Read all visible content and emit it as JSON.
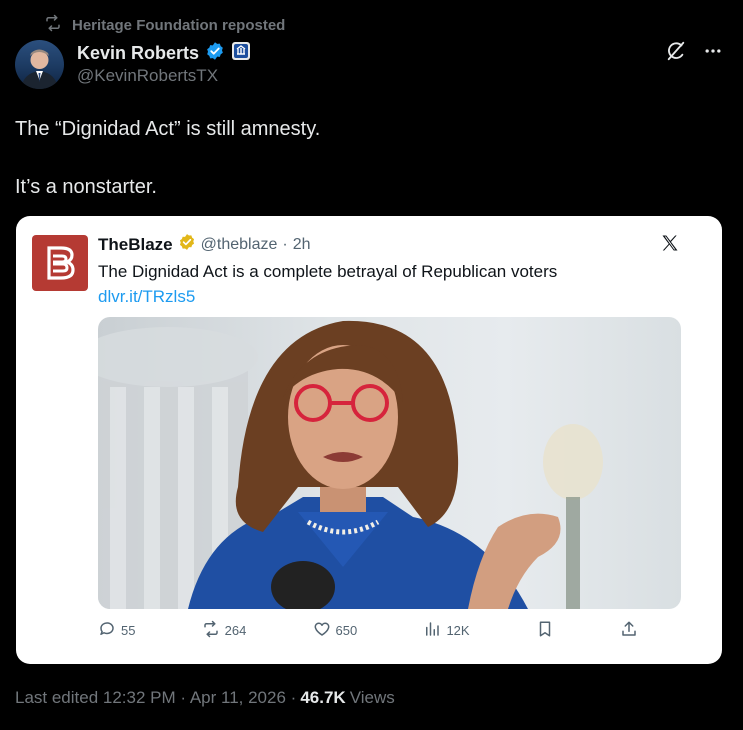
{
  "repost": {
    "text": "Heritage Foundation reposted"
  },
  "author": {
    "name": "Kevin Roberts",
    "handle": "@KevinRobertsTX"
  },
  "post": {
    "line1": "The “Dignidad Act” is still amnesty.",
    "line2": "It’s a nonstarter."
  },
  "embed": {
    "name": "TheBlaze",
    "handle": "@theblaze",
    "sep": "·",
    "time": "2h",
    "text": "The Dignidad Act is a complete betrayal of Republican voters ",
    "link": "dlvr.it/TRzls5",
    "metrics": {
      "replies": "55",
      "reposts": "264",
      "likes": "650",
      "views": "12K"
    }
  },
  "footer": {
    "edited": "Last edited 12:32 PM · Apr 11, 2026 ·",
    "views_count": "46.7K",
    "views_label": "Views"
  },
  "colors": {
    "link": "#1d9bf0",
    "verified": "#1d9bf0",
    "gold": "#e2b719",
    "brand": "#b53a33"
  },
  "icons": [
    "repost-icon",
    "verified-badge-icon",
    "gov-badge-icon",
    "grok-icon",
    "more-icon",
    "x-logo-icon",
    "reply-icon",
    "like-icon",
    "views-icon",
    "bookmark-icon",
    "share-icon"
  ]
}
